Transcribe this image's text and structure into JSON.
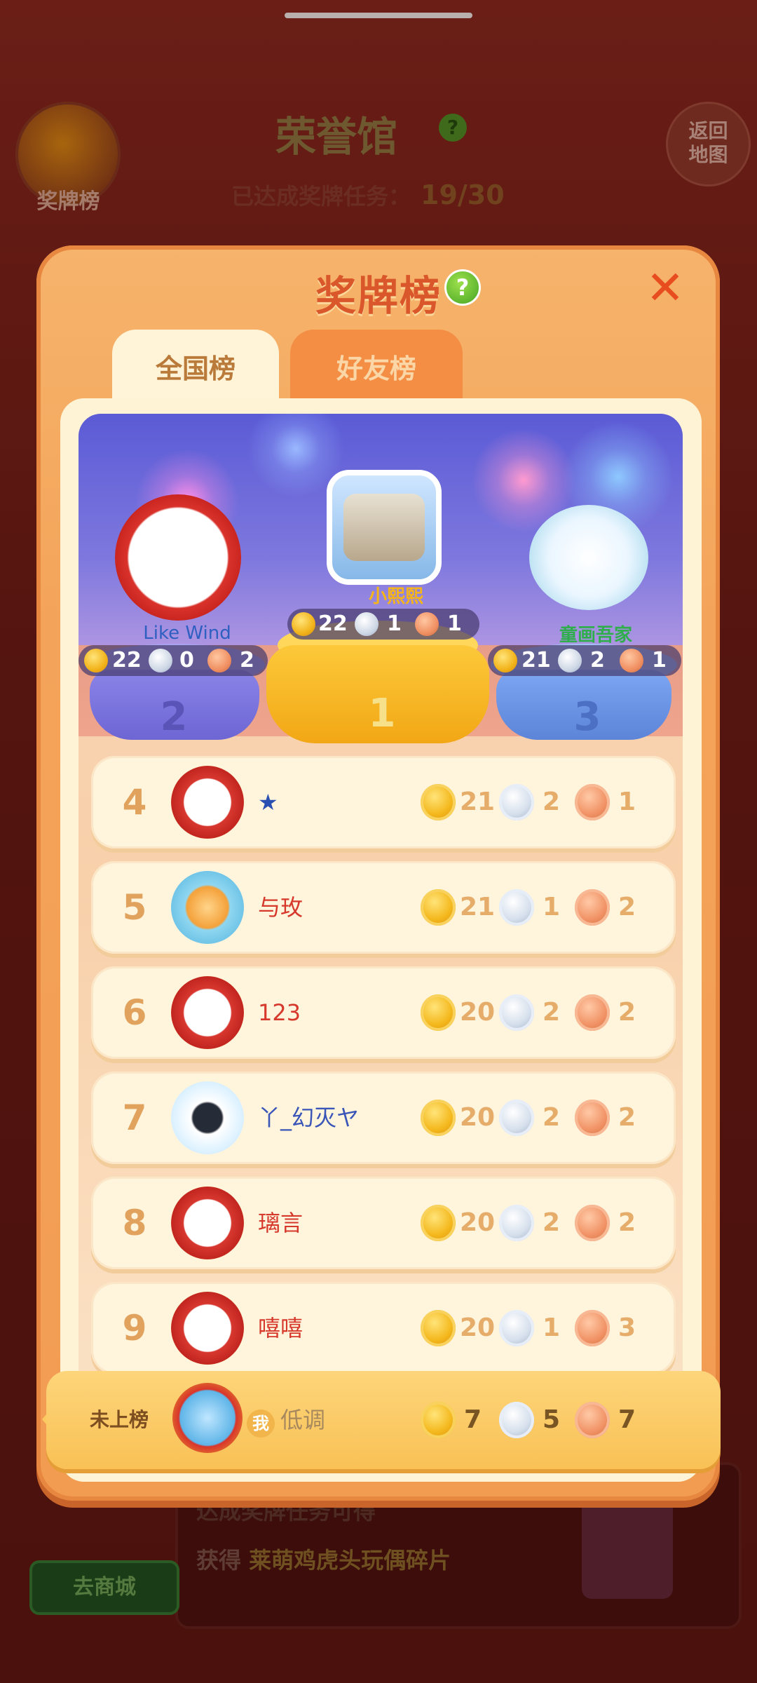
{
  "background": {
    "medal_board_button": "奖牌榜",
    "hall_title": "荣誉馆",
    "hall_help": "?",
    "back_to_map": [
      "返回",
      "地图"
    ],
    "progress_label": "已达成奖牌任务：",
    "progress_value": "19/30",
    "bottom_text_1": "达成奖牌任务可得",
    "bottom_text_2_prefix": "获得",
    "bottom_text_2_reward": "莱萌鸡虎头玩偶碎片",
    "shop_button": "去商城"
  },
  "dialog": {
    "title": "奖牌榜",
    "help": "?",
    "close": "✕",
    "tabs": [
      {
        "label": "全国榜",
        "active": true
      },
      {
        "label": "好友榜",
        "active": false
      }
    ]
  },
  "podium": [
    {
      "rank": "2",
      "name": "Like Wind",
      "gold": "22",
      "silver": "0",
      "bronze": "2"
    },
    {
      "rank": "1",
      "name": "小熙熙",
      "gold": "22",
      "silver": "1",
      "bronze": "1"
    },
    {
      "rank": "3",
      "name": "童画吾家",
      "gold": "21",
      "silver": "2",
      "bronze": "1"
    }
  ],
  "list": [
    {
      "rank": "4",
      "name": "★",
      "name_color": "#2a4fb3",
      "gold": "21",
      "silver": "2",
      "bronze": "1"
    },
    {
      "rank": "5",
      "name": "与玫",
      "name_color": "#d6392c",
      "gold": "21",
      "silver": "1",
      "bronze": "2"
    },
    {
      "rank": "6",
      "name": "123",
      "name_color": "#d6392c",
      "gold": "20",
      "silver": "2",
      "bronze": "2"
    },
    {
      "rank": "7",
      "name": "丫_幻灭ヤ",
      "name_color": "#3a55b8",
      "gold": "20",
      "silver": "2",
      "bronze": "2"
    },
    {
      "rank": "8",
      "name": "璃言",
      "name_color": "#d6392c",
      "gold": "20",
      "silver": "2",
      "bronze": "2"
    },
    {
      "rank": "9",
      "name": "嘻嘻",
      "name_color": "#d6392c",
      "gold": "20",
      "silver": "1",
      "bronze": "3"
    }
  ],
  "me": {
    "rank_text": "未上榜",
    "badge": "我",
    "name": "低调",
    "gold": "7",
    "silver": "5",
    "bronze": "7"
  },
  "colors": {
    "dialog_orange": "#f4a45a",
    "title_red": "#d9572a",
    "gold": "#f4b81d",
    "silver": "#d5dfec",
    "bronze": "#f19366"
  }
}
